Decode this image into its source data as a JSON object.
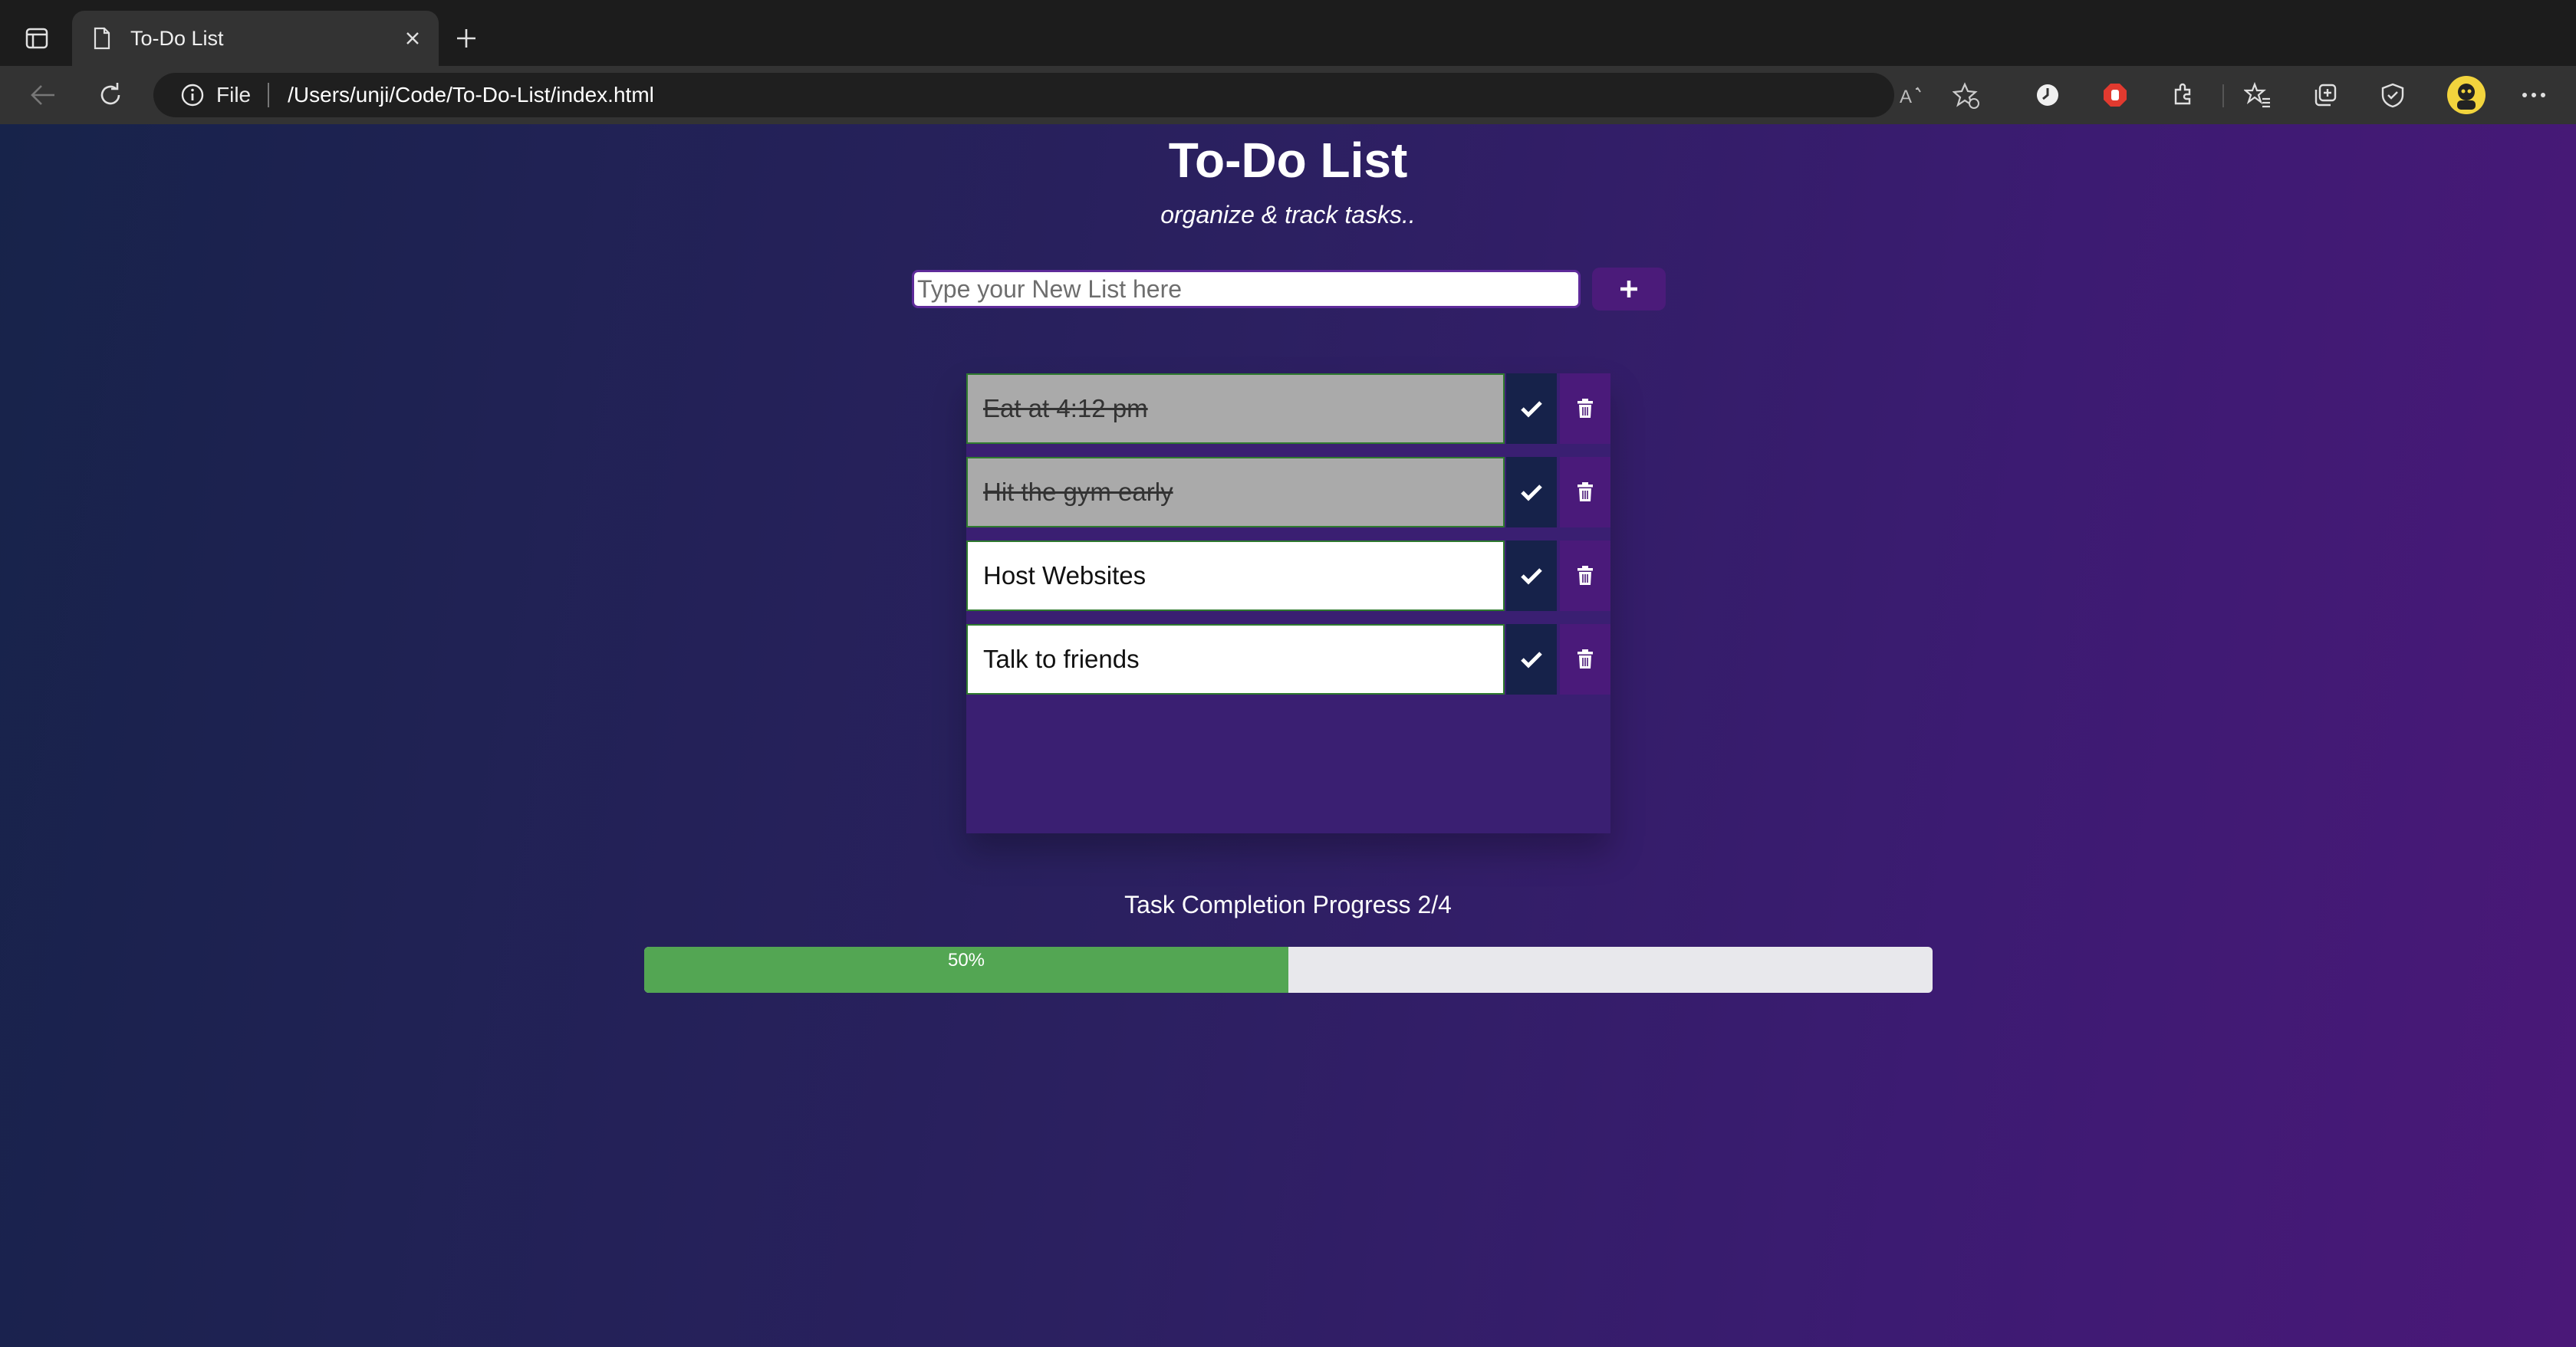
{
  "browser": {
    "tab_title": "To-Do List",
    "scheme_label": "File",
    "url": "/Users/unji/Code/To-Do-List/index.html",
    "icons": [
      "sidebar-toggle-icon",
      "page-icon",
      "close-icon",
      "plus-icon",
      "back-icon",
      "reload-icon",
      "info-icon",
      "read-aloud-icon",
      "favorite-add-icon",
      "history-icon",
      "adblock-icon",
      "extensions-icon",
      "favorites-icon",
      "collections-icon",
      "browser-essentials-icon",
      "avatar",
      "more-icon"
    ]
  },
  "app": {
    "title": "To-Do List",
    "subtitle": "organize & track tasks..",
    "input_placeholder": "Type your New List here",
    "add_button_icon": "plus-icon",
    "tasks": [
      {
        "text": "Eat at 4:12 pm",
        "completed": true
      },
      {
        "text": "Hit the gym early",
        "completed": true
      },
      {
        "text": "Host Websites",
        "completed": false
      },
      {
        "text": "Talk to friends",
        "completed": false
      }
    ],
    "progress": {
      "label": "Task Completion Progress 2/4",
      "percent_label": "50%",
      "fraction": 0.5,
      "fill_color": "#53a653",
      "track_color": "#e8e8ec"
    }
  },
  "colors": {
    "check_button": "#16224a",
    "delete_button": "#4a1a7a",
    "gradient_start": "#17234a",
    "gradient_end": "#4a1878"
  }
}
